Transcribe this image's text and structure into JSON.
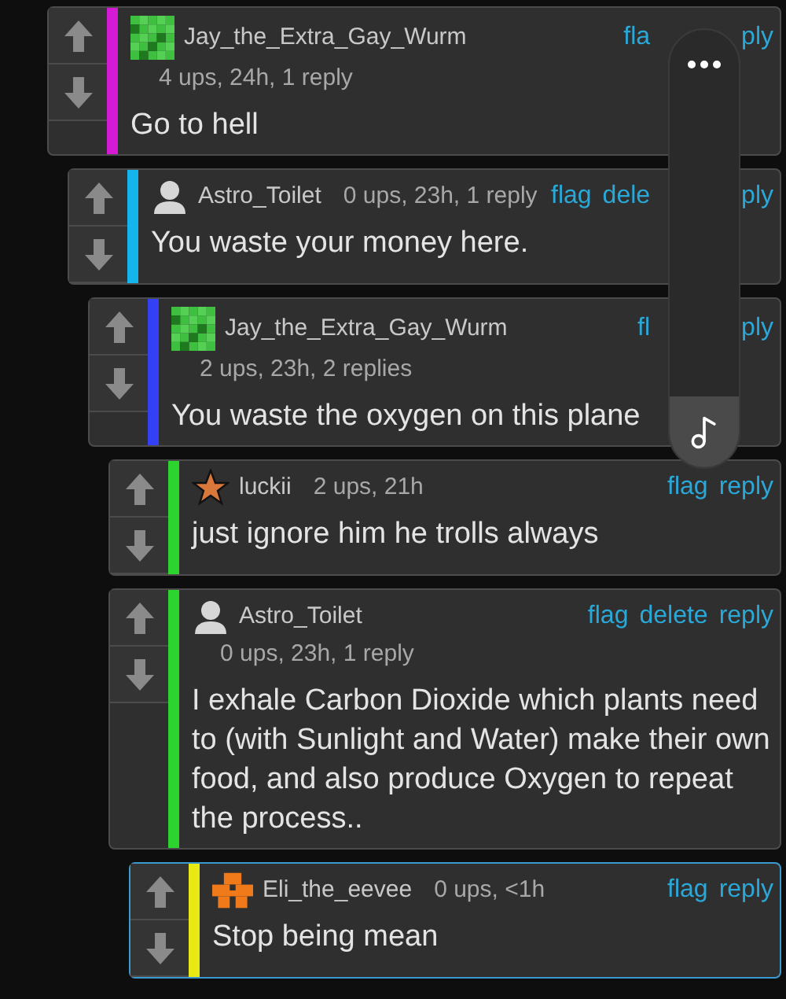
{
  "comments": [
    {
      "user": "Jay_the_Extra_Gay_Wurm",
      "kind": "pixel-green",
      "meta": "4 ups, 24h, 1 reply",
      "meta_wrapped": true,
      "color": "#d41ad4",
      "highlighted": false,
      "actions_before_overlay": [
        "fla"
      ],
      "actions_after_overlay": [
        "ply"
      ],
      "text": "Go to hell",
      "children": [
        {
          "user": "Astro_Toilet",
          "kind": "person",
          "meta": "0 ups, 23h, 1 reply",
          "meta_wrapped": false,
          "color": "#14b4ec",
          "highlighted": false,
          "actions_before_overlay": [
            "flag",
            "dele"
          ],
          "actions_after_overlay": [
            "ply"
          ],
          "text": "You waste your money here.",
          "children": [
            {
              "user": "Jay_the_Extra_Gay_Wurm",
              "kind": "pixel-green",
              "meta": "2 ups, 23h, 2 replies",
              "meta_wrapped": true,
              "color": "#3440f4",
              "highlighted": false,
              "actions_before_overlay": [
                "fl"
              ],
              "actions_after_overlay": [
                "ply"
              ],
              "text": "You waste the oxygen on this plane",
              "children": [
                {
                  "user": "luckii",
                  "kind": "star",
                  "meta": "2 ups, 21h",
                  "meta_wrapped": false,
                  "color": "#2ed42e",
                  "highlighted": false,
                  "actions": [
                    "flag",
                    "reply"
                  ],
                  "text": "just ignore him he trolls always"
                },
                {
                  "user": "Astro_Toilet",
                  "kind": "person",
                  "meta": "0 ups, 23h, 1 reply",
                  "meta_wrapped": true,
                  "color": "#2ed42e",
                  "highlighted": false,
                  "actions": [
                    "flag",
                    "delete",
                    "reply"
                  ],
                  "text": "I exhale Carbon Dioxide which plants need to (with Sunlight and Water) make their own food, and also produce Oxygen to repeat the process..",
                  "children": [
                    {
                      "user": "Eli_the_eevee",
                      "kind": "pixel-orange",
                      "meta": "0 ups, <1h",
                      "meta_wrapped": false,
                      "color": "#e8e814",
                      "highlighted": true,
                      "actions": [
                        "flag",
                        "reply"
                      ],
                      "text": "Stop being mean"
                    }
                  ]
                }
              ]
            }
          ]
        }
      ]
    }
  ]
}
